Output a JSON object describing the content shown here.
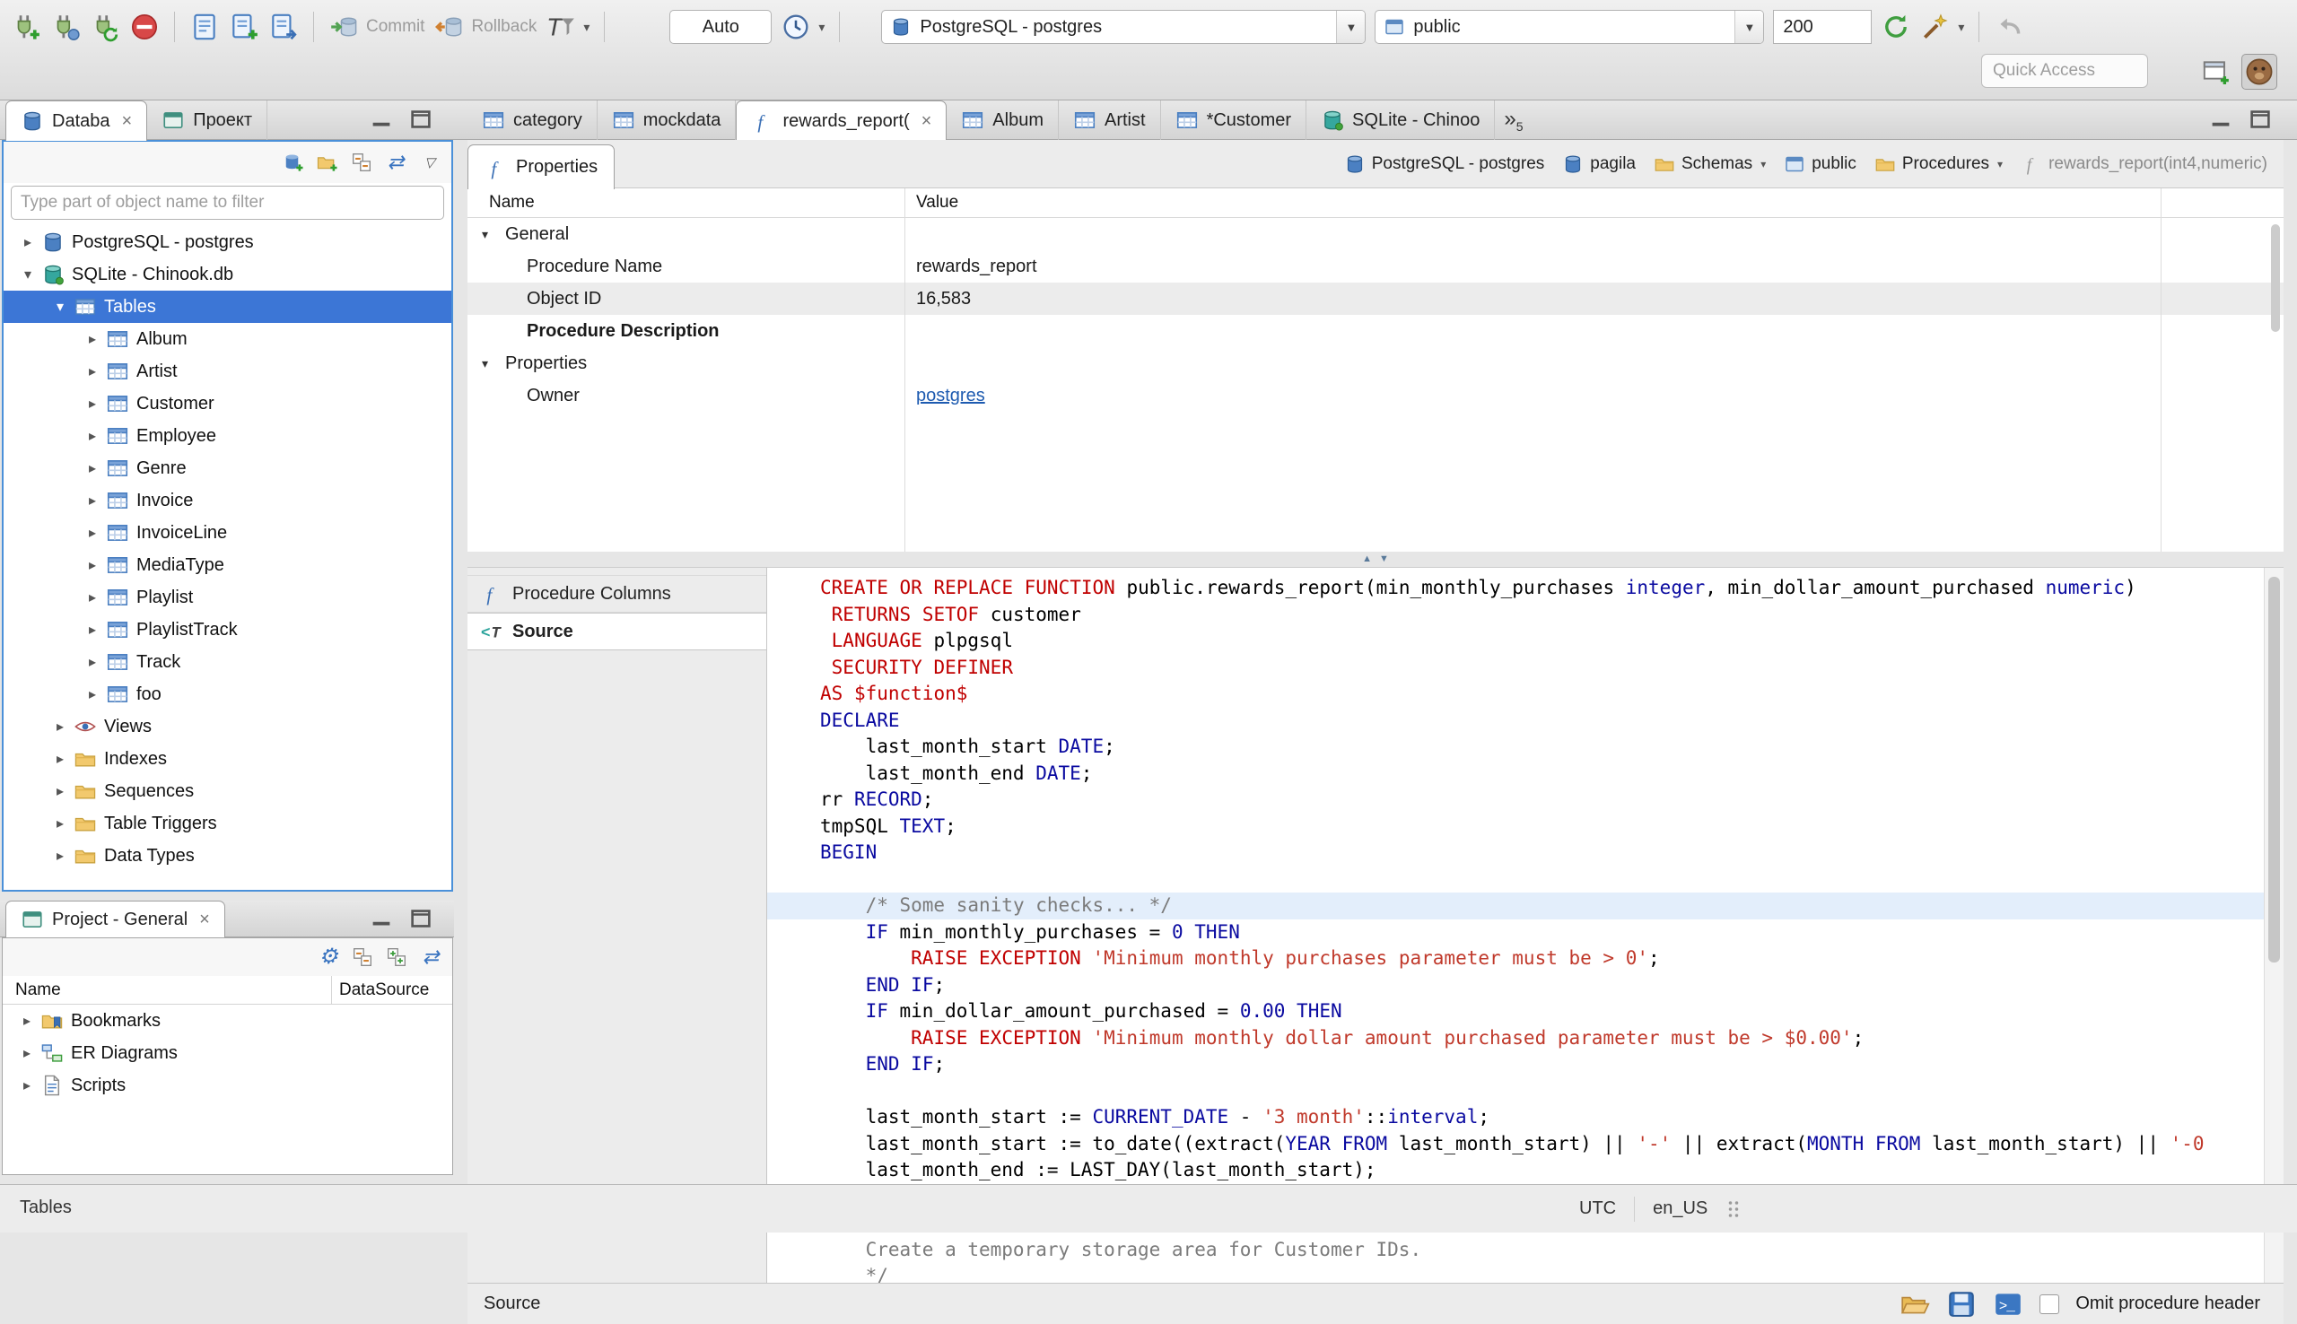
{
  "toolbar": {
    "commit_label": "Commit",
    "rollback_label": "Rollback",
    "auto_label": "Auto",
    "connection_label": "PostgreSQL - postgres",
    "schema_label": "public",
    "fetch_size": "200",
    "quick_access_placeholder": "Quick Access"
  },
  "sidebar": {
    "tabs": [
      {
        "label": "Databa",
        "active": true
      },
      {
        "label": "Проект"
      }
    ],
    "filter_placeholder": "Type part of object name to filter",
    "tree": [
      {
        "label": "PostgreSQL - postgres",
        "depth": 0,
        "icon": "db-blue",
        "arrow": "collapsed"
      },
      {
        "label": "SQLite - Chinook.db",
        "depth": 0,
        "icon": "db-teal",
        "arrow": "expanded"
      },
      {
        "label": "Tables",
        "depth": 1,
        "icon": "table",
        "arrow": "expanded",
        "selected": true
      },
      {
        "label": "Album",
        "depth": 2,
        "icon": "table",
        "arrow": "collapsed"
      },
      {
        "label": "Artist",
        "depth": 2,
        "icon": "table",
        "arrow": "collapsed"
      },
      {
        "label": "Customer",
        "depth": 2,
        "icon": "table",
        "arrow": "collapsed"
      },
      {
        "label": "Employee",
        "depth": 2,
        "icon": "table",
        "arrow": "collapsed"
      },
      {
        "label": "Genre",
        "depth": 2,
        "icon": "table",
        "arrow": "collapsed"
      },
      {
        "label": "Invoice",
        "depth": 2,
        "icon": "table",
        "arrow": "collapsed"
      },
      {
        "label": "InvoiceLine",
        "depth": 2,
        "icon": "table",
        "arrow": "collapsed"
      },
      {
        "label": "MediaType",
        "depth": 2,
        "icon": "table",
        "arrow": "collapsed"
      },
      {
        "label": "Playlist",
        "depth": 2,
        "icon": "table",
        "arrow": "collapsed"
      },
      {
        "label": "PlaylistTrack",
        "depth": 2,
        "icon": "table",
        "arrow": "collapsed"
      },
      {
        "label": "Track",
        "depth": 2,
        "icon": "table",
        "arrow": "collapsed"
      },
      {
        "label": "foo",
        "depth": 2,
        "icon": "table",
        "arrow": "collapsed"
      },
      {
        "label": "Views",
        "depth": 1,
        "icon": "views",
        "arrow": "collapsed"
      },
      {
        "label": "Indexes",
        "depth": 1,
        "icon": "folder",
        "arrow": "collapsed"
      },
      {
        "label": "Sequences",
        "depth": 1,
        "icon": "folder",
        "arrow": "collapsed"
      },
      {
        "label": "Table Triggers",
        "depth": 1,
        "icon": "folder",
        "arrow": "collapsed"
      },
      {
        "label": "Data Types",
        "depth": 1,
        "icon": "folder",
        "arrow": "collapsed"
      }
    ]
  },
  "project_panel": {
    "title": "Project - General",
    "columns": [
      "Name",
      "DataSource"
    ],
    "items": [
      {
        "label": "Bookmarks",
        "icon": "bookmarks"
      },
      {
        "label": "ER Diagrams",
        "icon": "er"
      },
      {
        "label": "Scripts",
        "icon": "scripts"
      }
    ]
  },
  "editor_tabs": [
    {
      "label": "category",
      "icon": "table"
    },
    {
      "label": "mockdata",
      "icon": "table"
    },
    {
      "label": "rewards_report(",
      "icon": "function",
      "active": true,
      "closable": true
    },
    {
      "label": "Album",
      "icon": "table"
    },
    {
      "label": "Artist",
      "icon": "table"
    },
    {
      "label": "*Customer",
      "icon": "table"
    },
    {
      "label": "SQLite - Chinoo",
      "icon": "db-teal"
    }
  ],
  "editor_tab_overflow": "5",
  "properties_view": {
    "tab_label": "Properties",
    "breadcrumb": [
      {
        "label": "PostgreSQL - postgres",
        "icon": "db-blue"
      },
      {
        "label": "pagila",
        "icon": "db-blue"
      },
      {
        "label": "Schemas",
        "icon": "folder",
        "dropdown": true
      },
      {
        "label": "public",
        "icon": "schema"
      },
      {
        "label": "Procedures",
        "icon": "folder",
        "dropdown": true
      },
      {
        "label": "rewards_report(int4,numeric)",
        "icon": "function-gray",
        "muted": true
      }
    ],
    "grid": {
      "columns": [
        "Name",
        "Value"
      ],
      "rows": [
        {
          "name": "General",
          "group": true
        },
        {
          "name": "Procedure Name",
          "value": "rewards_report"
        },
        {
          "name": "Object ID",
          "value": "16,583",
          "shaded": true
        },
        {
          "name": "Procedure Description",
          "bold": true
        },
        {
          "name": "Properties",
          "group": true
        },
        {
          "name": "Owner",
          "value": "postgres",
          "link": true
        }
      ]
    },
    "subtabs": [
      {
        "label": "Procedure Columns",
        "icon": "function"
      },
      {
        "label": "Source",
        "icon": "source",
        "active": true
      }
    ]
  },
  "source": {
    "footer_label": "Source",
    "omit_label": "Omit procedure header",
    "highlight_line": 12,
    "lines": [
      "CREATE OR REPLACE FUNCTION public.rewards_report(min_monthly_purchases integer, min_dollar_amount_purchased numeric)",
      " RETURNS SETOF customer",
      " LANGUAGE plpgsql",
      " SECURITY DEFINER",
      "AS $function$",
      "DECLARE",
      "    last_month_start DATE;",
      "    last_month_end DATE;",
      "rr RECORD;",
      "tmpSQL TEXT;",
      "BEGIN",
      "",
      "    /* Some sanity checks... */",
      "    IF min_monthly_purchases = 0 THEN",
      "        RAISE EXCEPTION 'Minimum monthly purchases parameter must be > 0';",
      "    END IF;",
      "    IF min_dollar_amount_purchased = 0.00 THEN",
      "        RAISE EXCEPTION 'Minimum monthly dollar amount purchased parameter must be > $0.00';",
      "    END IF;",
      "",
      "    last_month_start := CURRENT_DATE - '3 month'::interval;",
      "    last_month_start := to_date((extract(YEAR FROM last_month_start) || '-' || extract(MONTH FROM last_month_start) || '-0",
      "    last_month_end := LAST_DAY(last_month_start);",
      "",
      "    /*",
      "    Create a temporary storage area for Customer IDs.",
      "    */"
    ]
  },
  "statusbar": {
    "left_label": "Tables",
    "timezone": "UTC",
    "locale": "en_US"
  },
  "colors": {
    "selection_blue": "#3c76d6",
    "focus_border_blue": "#4a90d9",
    "link_blue": "#1e5bb0",
    "keyword_red": "#c00000",
    "keyword_blue": "#0a0aa0",
    "string_color": "#c0392b",
    "comment_gray": "#7b7b7b",
    "line_highlight": "#e3eefb"
  }
}
